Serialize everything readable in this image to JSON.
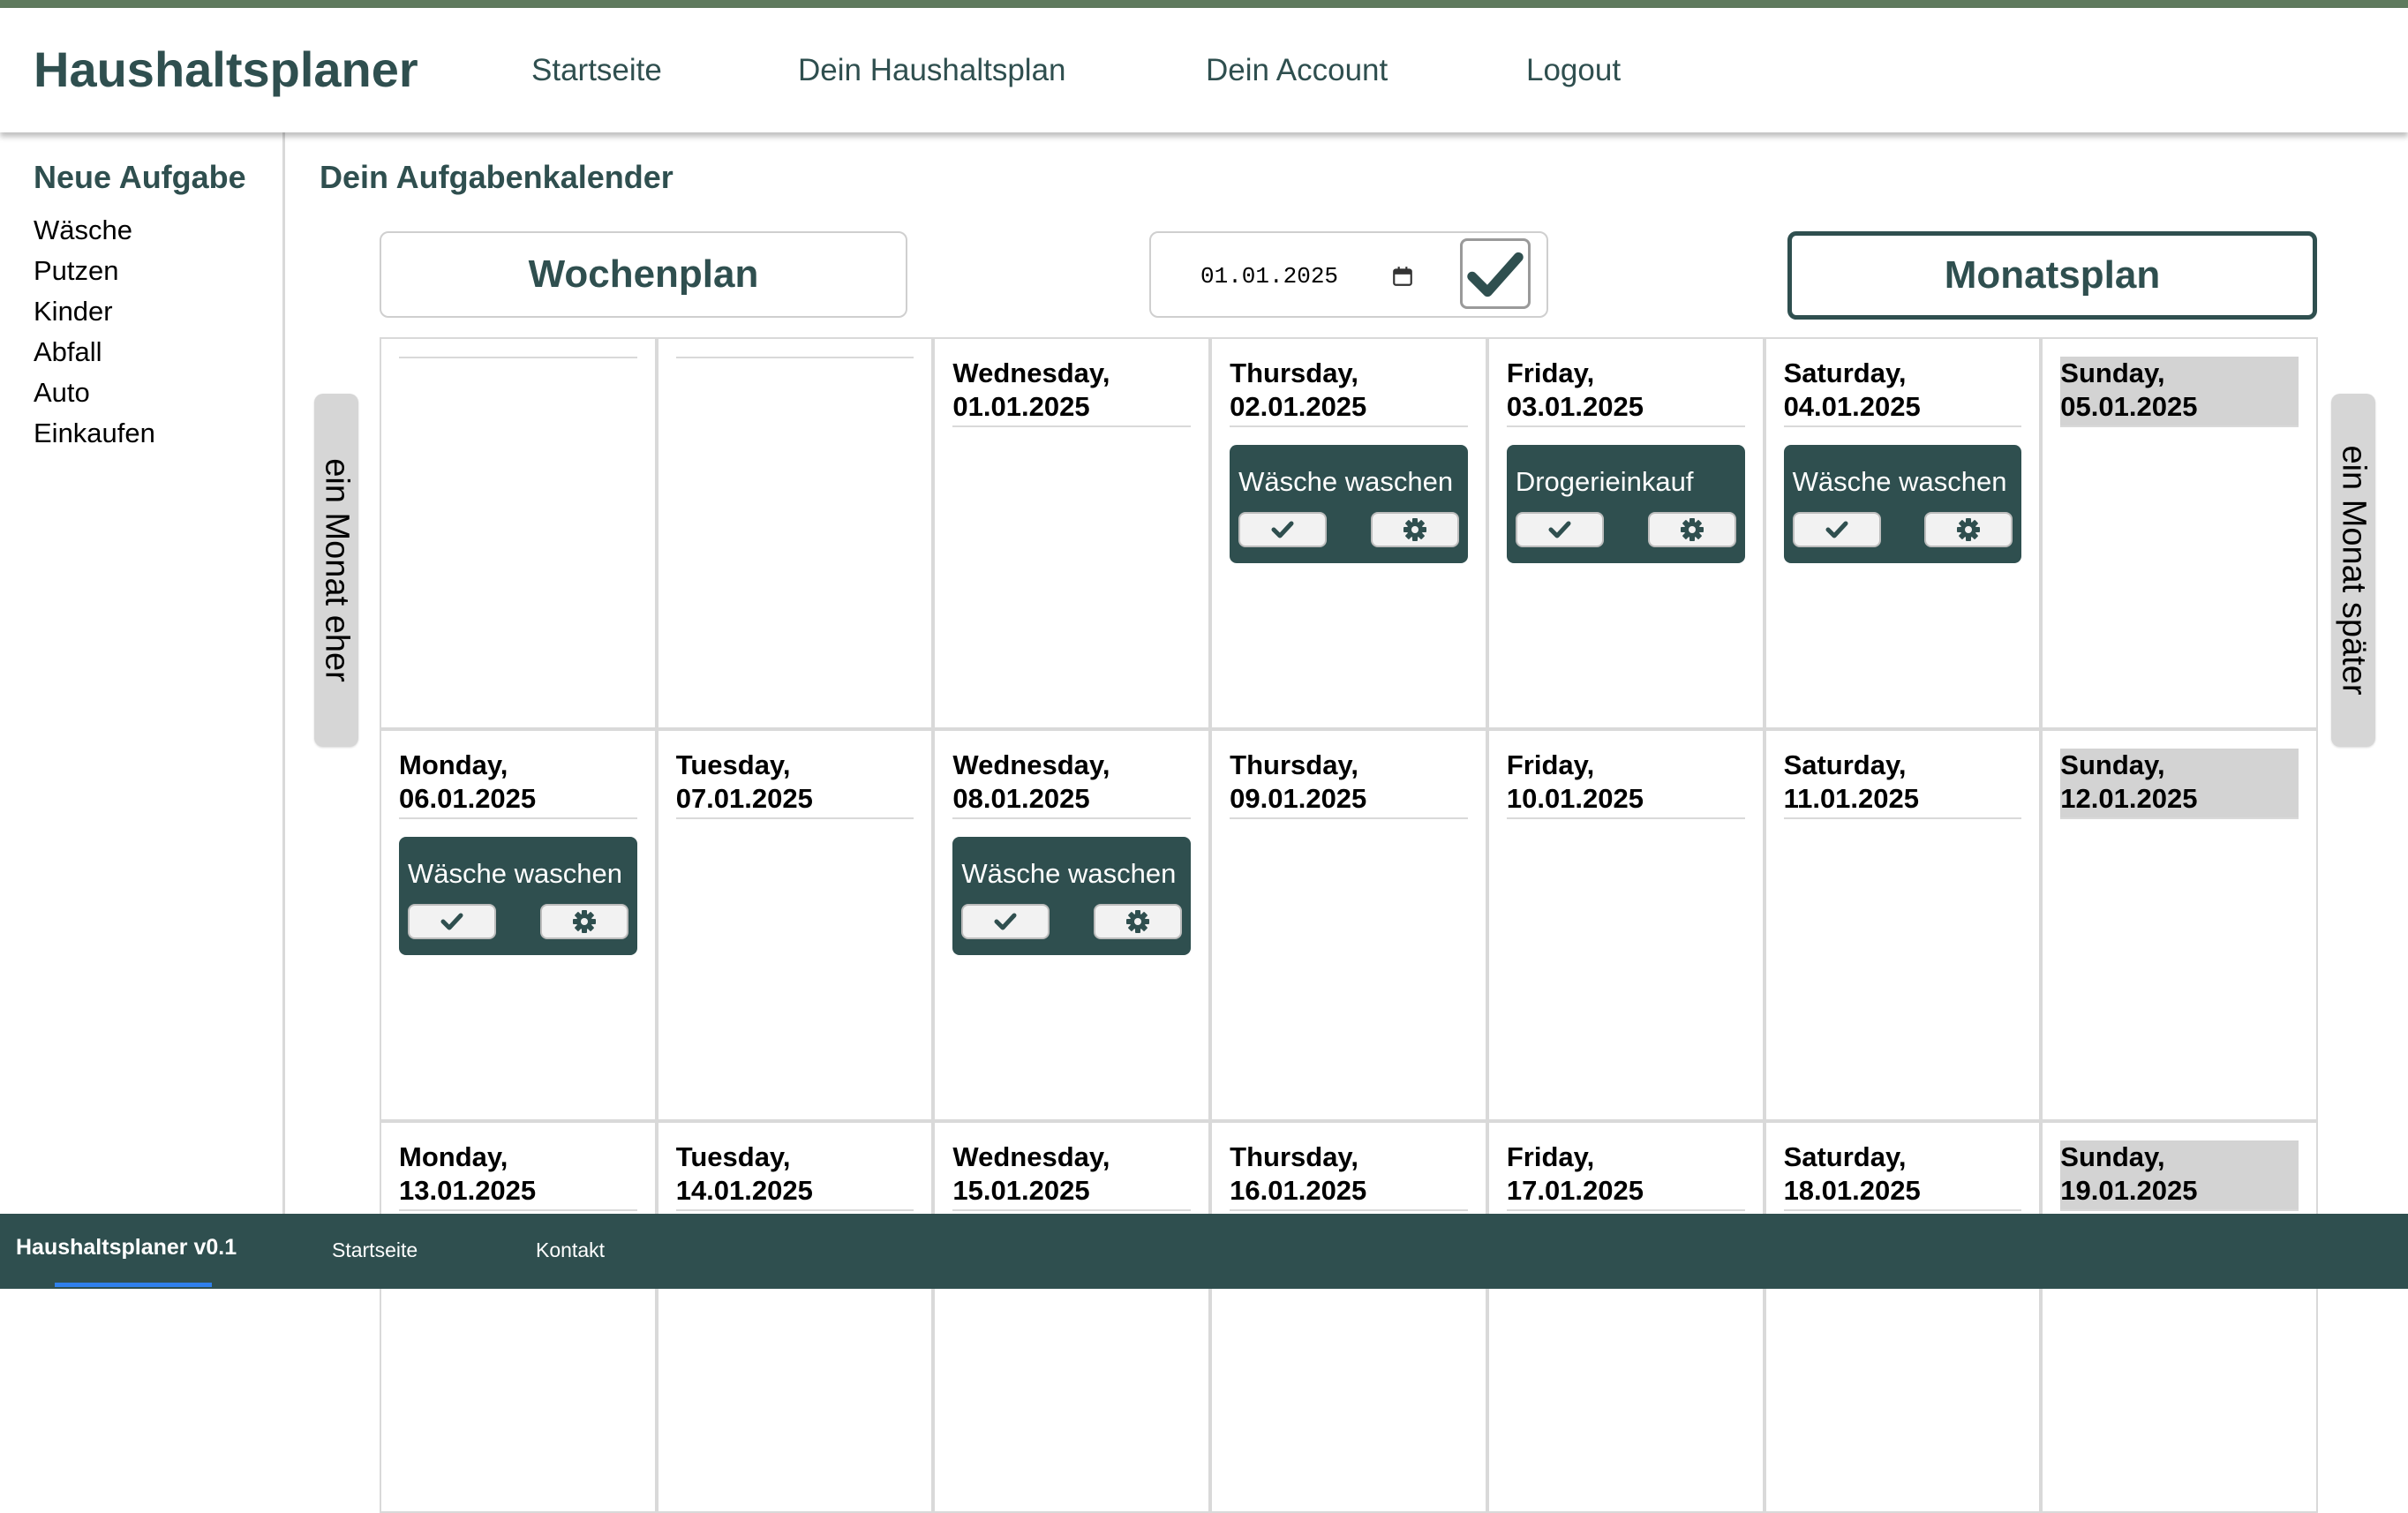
{
  "colors": {
    "primary": "#2f4f4f",
    "stripe": "#5f7a5e",
    "sunday_highlight": "#d3d3d3",
    "month_nav_bg": "#d6d6d6",
    "footer_underline": "#2f80ed"
  },
  "header": {
    "brand": "Haushaltsplaner",
    "nav": [
      "Startseite",
      "Dein Haushaltsplan",
      "Dein Account",
      "Logout"
    ]
  },
  "sidebar": {
    "title": "Neue Aufgabe",
    "items": [
      "Wäsche",
      "Putzen",
      "Kinder",
      "Abfall",
      "Auto",
      "Einkaufen"
    ]
  },
  "main": {
    "title": "Dein Aufgabenkalender",
    "week_button": "Wochenplan",
    "month_button": "Monatsplan",
    "date_value": "01.01.2025",
    "prev_month": "ein Monat eher",
    "next_month": "ein Monat später"
  },
  "calendar": {
    "cells": [
      {
        "label": "",
        "tasks": []
      },
      {
        "label": "",
        "tasks": []
      },
      {
        "label": "Wednesday,\n01.01.2025",
        "tasks": []
      },
      {
        "label": "Thursday,\n02.01.2025",
        "tasks": [
          "Wäsche waschen"
        ]
      },
      {
        "label": "Friday,\n03.01.2025",
        "tasks": [
          "Drogerieinkauf"
        ]
      },
      {
        "label": "Saturday,\n04.01.2025",
        "tasks": [
          "Wäsche waschen"
        ]
      },
      {
        "label": "Sunday,\n05.01.2025",
        "tasks": [],
        "sunday": true
      },
      {
        "label": "Monday,\n06.01.2025",
        "tasks": [
          "Wäsche waschen"
        ]
      },
      {
        "label": "Tuesday,\n07.01.2025",
        "tasks": []
      },
      {
        "label": "Wednesday,\n08.01.2025",
        "tasks": [
          "Wäsche waschen"
        ]
      },
      {
        "label": "Thursday,\n09.01.2025",
        "tasks": []
      },
      {
        "label": "Friday,\n10.01.2025",
        "tasks": []
      },
      {
        "label": "Saturday,\n11.01.2025",
        "tasks": []
      },
      {
        "label": "Sunday,\n12.01.2025",
        "tasks": [],
        "sunday": true
      },
      {
        "label": "Monday,\n13.01.2025",
        "tasks": []
      },
      {
        "label": "Tuesday,\n14.01.2025",
        "tasks": []
      },
      {
        "label": "Wednesday,\n15.01.2025",
        "tasks": []
      },
      {
        "label": "Thursday,\n16.01.2025",
        "tasks": []
      },
      {
        "label": "Friday,\n17.01.2025",
        "tasks": []
      },
      {
        "label": "Saturday,\n18.01.2025",
        "tasks": []
      },
      {
        "label": "Sunday,\n19.01.2025",
        "tasks": [],
        "sunday": true
      }
    ]
  },
  "footer": {
    "brand": "Haushaltsplaner v0.1",
    "links": [
      "Startseite",
      "Kontakt"
    ]
  },
  "icons": {
    "confirm": "check-icon",
    "task_done": "check-icon",
    "task_settings": "gear-icon",
    "date_picker": "calendar-icon"
  }
}
